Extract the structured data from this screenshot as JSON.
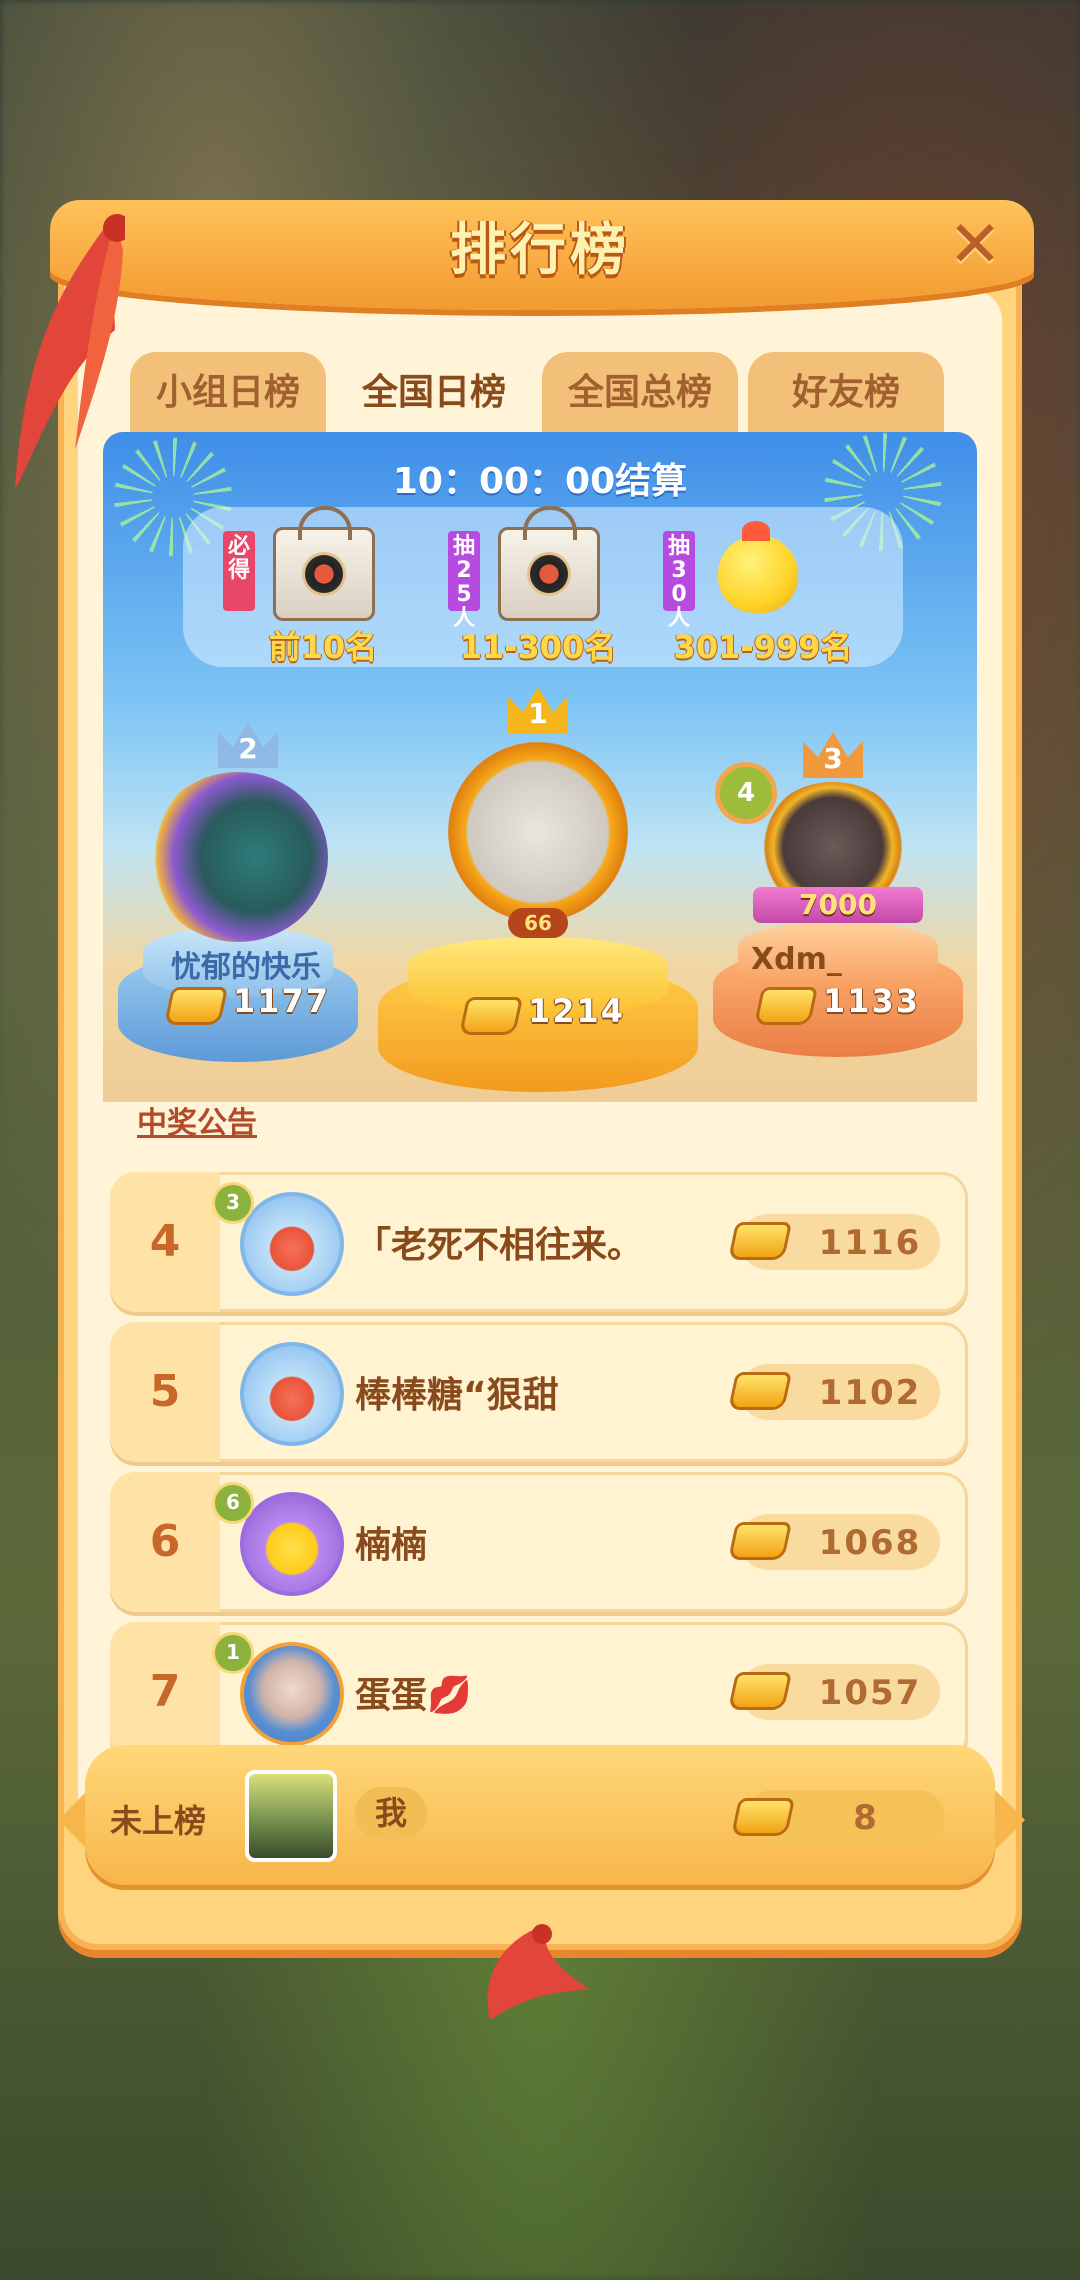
{
  "title": "排行榜",
  "close_label": "✕",
  "tabs": [
    {
      "label": "小组日榜",
      "active": false
    },
    {
      "label": "全国日榜",
      "active": true
    },
    {
      "label": "全国总榜",
      "active": false
    },
    {
      "label": "好友榜",
      "active": false
    }
  ],
  "countdown": "10：00：00结算",
  "rewards": [
    {
      "tag": "必得",
      "tag_color": "#e8476a",
      "label": "前10名",
      "icon": "bag-icon"
    },
    {
      "tag": "抽25人",
      "tag_color": "#b64be0",
      "label": "11-300名",
      "icon": "bag-icon"
    },
    {
      "tag": "抽30人",
      "tag_color": "#b64be0",
      "label": "301-999名",
      "icon": "chick-icon"
    }
  ],
  "podium": [
    {
      "rank": "2",
      "name": "忧郁的快乐",
      "score": "1177"
    },
    {
      "rank": "1",
      "name": "",
      "score": "1214",
      "level": "66"
    },
    {
      "rank": "3",
      "name": "Xdm_",
      "score": "1133",
      "badge": "4",
      "banner": "7000"
    }
  ],
  "announcement": "中奖公告",
  "rows": [
    {
      "rank": "4",
      "badge": "3",
      "name": "「老死不相往来。",
      "score": "1116"
    },
    {
      "rank": "5",
      "badge": "",
      "name": "棒棒糖“狠甜",
      "score": "1102"
    },
    {
      "rank": "6",
      "badge": "6",
      "name": "楠楠",
      "score": "1068"
    },
    {
      "rank": "7",
      "badge": "1",
      "name": "蛋蛋💋",
      "score": "1057"
    }
  ],
  "me": {
    "status": "未上榜",
    "name": "我",
    "score": "8"
  },
  "colors": {
    "panel": "#ffd47e",
    "accent": "#f29a2f",
    "text_brown": "#8a4b1c"
  }
}
